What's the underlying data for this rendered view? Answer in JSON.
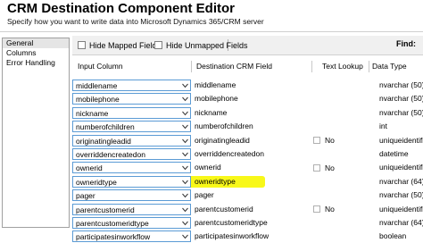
{
  "title": "CRM Destination Component Editor",
  "subtitle": "Specify how you want to write data into Microsoft Dynamics 365/CRM server",
  "sidebar": {
    "items": [
      {
        "label": "General"
      },
      {
        "label": "Columns"
      },
      {
        "label": "Error Handling"
      }
    ]
  },
  "toolbar": {
    "hide_mapped": "Hide Mapped Fields",
    "hide_unmapped": "Hide Unmapped Fields",
    "find": "Find:"
  },
  "grid": {
    "columns": [
      "Input Column",
      "Destination CRM Field",
      "Text Lookup",
      "Data Type"
    ],
    "rows": [
      {
        "input": "middlename",
        "dest": "middlename",
        "lookup": "",
        "type": "nvarchar (50)"
      },
      {
        "input": "mobilephone",
        "dest": "mobilephone",
        "lookup": "",
        "type": "nvarchar (50)"
      },
      {
        "input": "nickname",
        "dest": "nickname",
        "lookup": "",
        "type": "nvarchar (50)"
      },
      {
        "input": "numberofchildren",
        "dest": "numberofchildren",
        "lookup": "",
        "type": "int"
      },
      {
        "input": "originatingleadid",
        "dest": "originatingleadid",
        "lookup": "No",
        "type": "uniqueidentifier"
      },
      {
        "input": "overriddencreatedon",
        "dest": "overriddencreatedon",
        "lookup": "",
        "type": "datetime"
      },
      {
        "input": "ownerid",
        "dest": "ownerid",
        "lookup": "No",
        "type": "uniqueidentifier"
      },
      {
        "input": "owneridtype",
        "dest": "owneridtype",
        "lookup": "",
        "type": "nvarchar (64)"
      },
      {
        "input": "pager",
        "dest": "pager",
        "lookup": "",
        "type": "nvarchar (50)"
      },
      {
        "input": "parentcustomerid",
        "dest": "parentcustomerid",
        "lookup": "No",
        "type": "uniqueidentifier"
      },
      {
        "input": "parentcustomeridtype",
        "dest": "parentcustomeridtype",
        "lookup": "",
        "type": "nvarchar (64)"
      },
      {
        "input": "participatesinworkflow",
        "dest": "participatesinworkflow",
        "lookup": "",
        "type": "boolean"
      }
    ]
  },
  "highlight": {
    "color": "#f7f700",
    "row_index": 7
  },
  "colors": {
    "input_border": "#5b9bd5"
  }
}
